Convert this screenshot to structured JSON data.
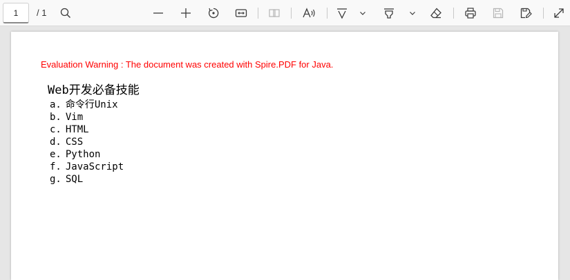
{
  "toolbar": {
    "page_number": "1",
    "page_total": "/ 1",
    "buttons": [
      {
        "name": "search-icon",
        "label": "Find",
        "enabled": true
      },
      {
        "name": "zoom-out-icon",
        "label": "Zoom out",
        "enabled": true
      },
      {
        "name": "zoom-in-icon",
        "label": "Zoom in",
        "enabled": true
      },
      {
        "name": "rotate-icon",
        "label": "Rotate",
        "enabled": true
      },
      {
        "name": "fit-width-icon",
        "label": "Fit to width",
        "enabled": true
      },
      {
        "name": "page-view-icon",
        "label": "Page view",
        "enabled": false
      },
      {
        "name": "read-aloud-icon",
        "label": "Read aloud",
        "enabled": true
      },
      {
        "name": "draw-icon",
        "label": "Draw",
        "enabled": true
      },
      {
        "name": "draw-options-chevron-icon",
        "label": "Draw options",
        "enabled": true
      },
      {
        "name": "highlight-icon",
        "label": "Highlight",
        "enabled": true
      },
      {
        "name": "highlight-options-chevron-icon",
        "label": "Highlight options",
        "enabled": true
      },
      {
        "name": "eraser-icon",
        "label": "Erase",
        "enabled": true
      },
      {
        "name": "print-icon",
        "label": "Print",
        "enabled": true
      },
      {
        "name": "save-icon",
        "label": "Save",
        "enabled": false
      },
      {
        "name": "save-as-icon",
        "label": "Save as",
        "enabled": true
      },
      {
        "name": "fullscreen-icon",
        "label": "Full screen",
        "enabled": true
      }
    ]
  },
  "document": {
    "warning": "Evaluation Warning : The document was created with Spire.PDF for Java.",
    "title": "Web开发必备技能",
    "items": [
      {
        "marker": "a.",
        "text": "命令行Unix"
      },
      {
        "marker": "b.",
        "text": "Vim"
      },
      {
        "marker": "c.",
        "text": "HTML"
      },
      {
        "marker": "d.",
        "text": "CSS"
      },
      {
        "marker": "e.",
        "text": "Python"
      },
      {
        "marker": "f.",
        "text": "JavaScript"
      },
      {
        "marker": "g.",
        "text": "SQL"
      }
    ]
  },
  "colors": {
    "warning": "#ff0000",
    "icon": "#3b3b3b",
    "icon_disabled": "#b5b5b5",
    "toolbar_bg": "#f9f9f9",
    "viewer_bg": "#e6e6e6"
  }
}
